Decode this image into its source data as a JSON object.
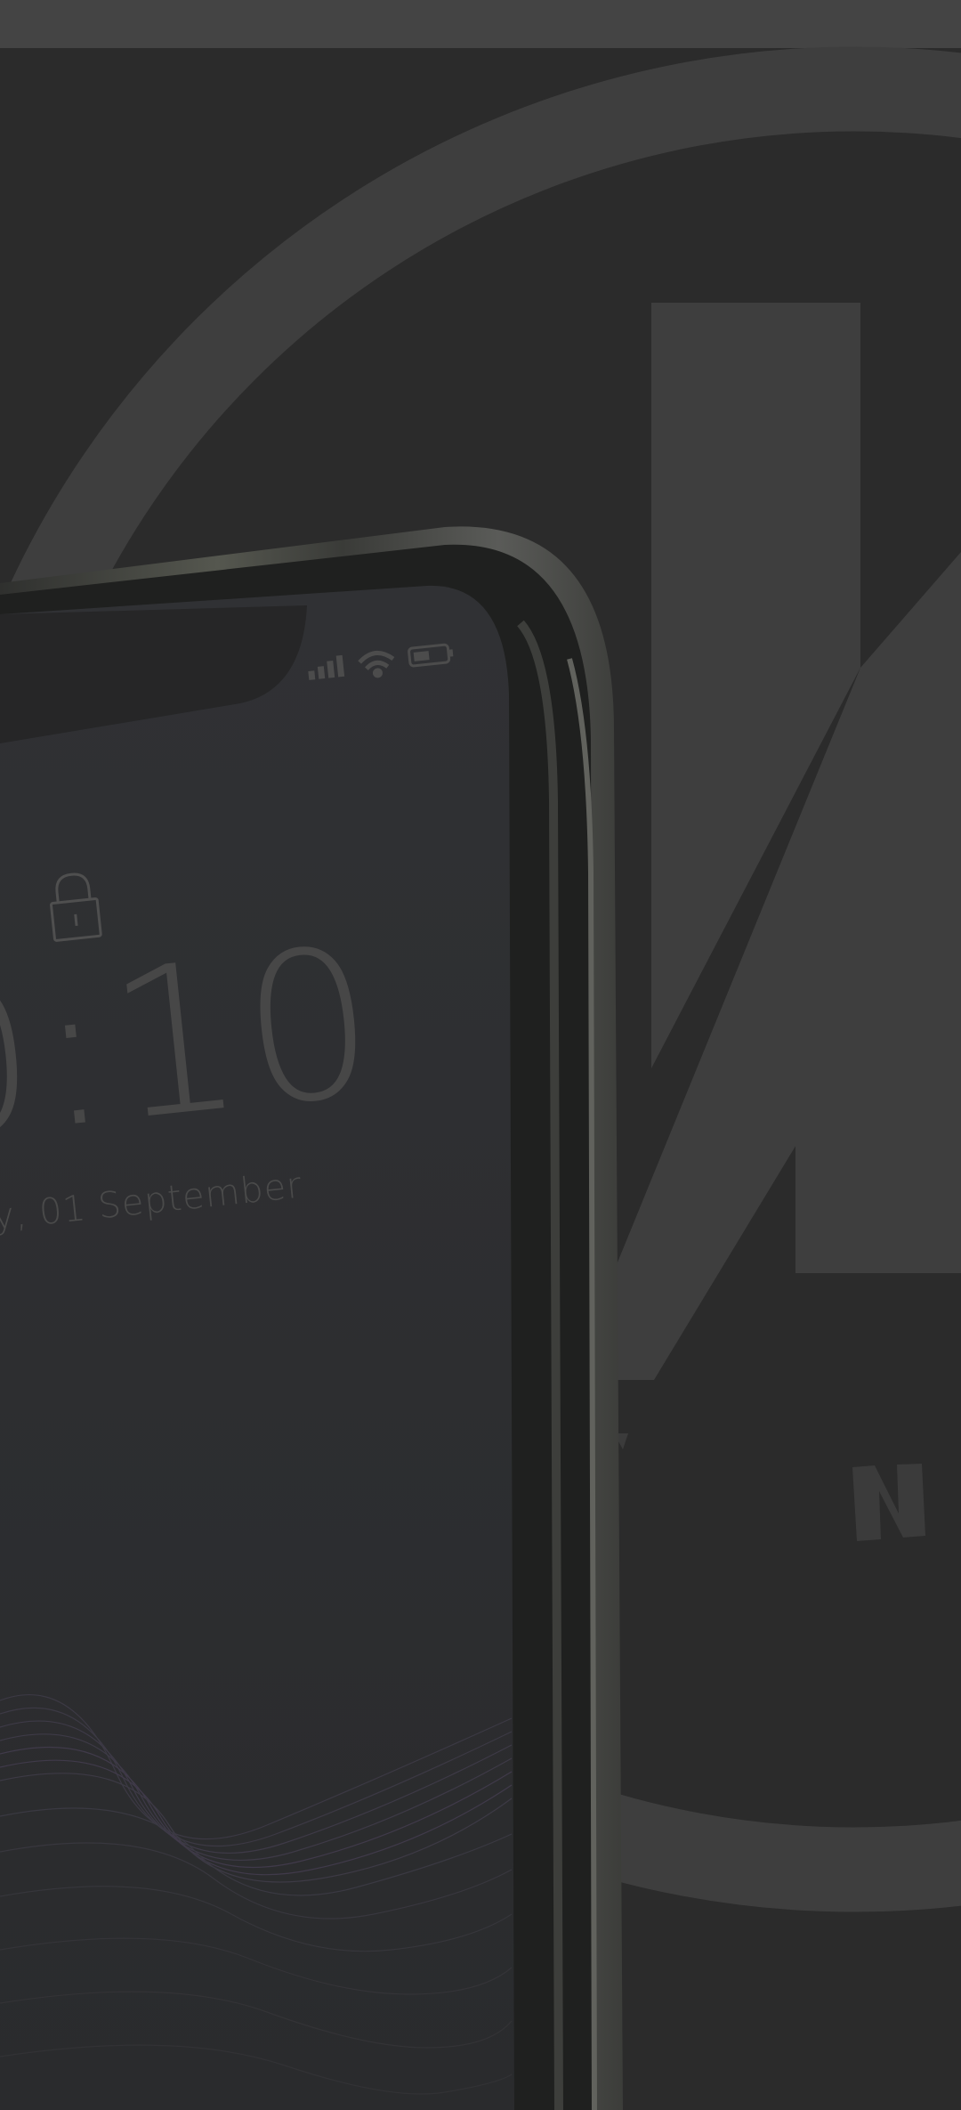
{
  "lockscreen": {
    "time": "0:10",
    "date": "y, 01 September"
  },
  "colors": {
    "background": "#2b2b2b",
    "status_bar": "#444444",
    "logo_shape": "#3e3e3e",
    "phone_frame": "#4a4b48",
    "screen": "#2d2e30"
  },
  "icons": [
    "lock-icon",
    "signal-icon",
    "wifi-icon",
    "battery-icon",
    "logo-emblem"
  ]
}
